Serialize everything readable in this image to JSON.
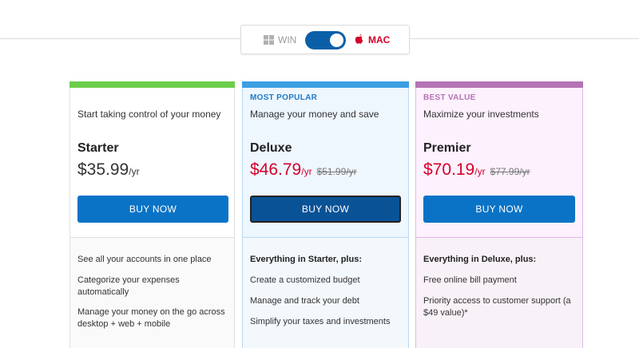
{
  "os_toggle": {
    "win_label": "WIN",
    "mac_label": "MAC",
    "selected": "MAC",
    "win_icon": "windows-icon",
    "mac_icon": "apple-icon"
  },
  "colors": {
    "starter_accent": "#6ccd4a",
    "deluxe_accent": "#3b9fe2",
    "premier_accent": "#b574b3",
    "price_red": "#d4002a",
    "button_blue": "#0a73c6"
  },
  "plans": [
    {
      "badge": "",
      "tagline": "Start taking control of your money",
      "name": "Starter",
      "price": "$35.99",
      "per": "/yr",
      "old_price": "",
      "button": "BUY NOW",
      "features": [
        "See all your accounts in one place",
        "Categorize your expenses automatically",
        "Manage your money on the go across desktop + web + mobile"
      ]
    },
    {
      "badge": "MOST POPULAR",
      "tagline": "Manage your money and save",
      "name": "Deluxe",
      "price": "$46.79",
      "per": "/yr",
      "old_price": "$51.99/yr",
      "button": "BUY NOW",
      "features_heading": "Everything in Starter, plus:",
      "features": [
        "Create a customized budget",
        "Manage and track your debt",
        "Simplify your taxes and investments"
      ]
    },
    {
      "badge": "BEST VALUE",
      "tagline": "Maximize your investments",
      "name": "Premier",
      "price": "$70.19",
      "per": "/yr",
      "old_price": "$77.99/yr",
      "button": "BUY NOW",
      "features_heading": "Everything in Deluxe, plus:",
      "features": [
        "Free online bill payment",
        "Priority access to customer support (a $49 value)*"
      ]
    }
  ]
}
